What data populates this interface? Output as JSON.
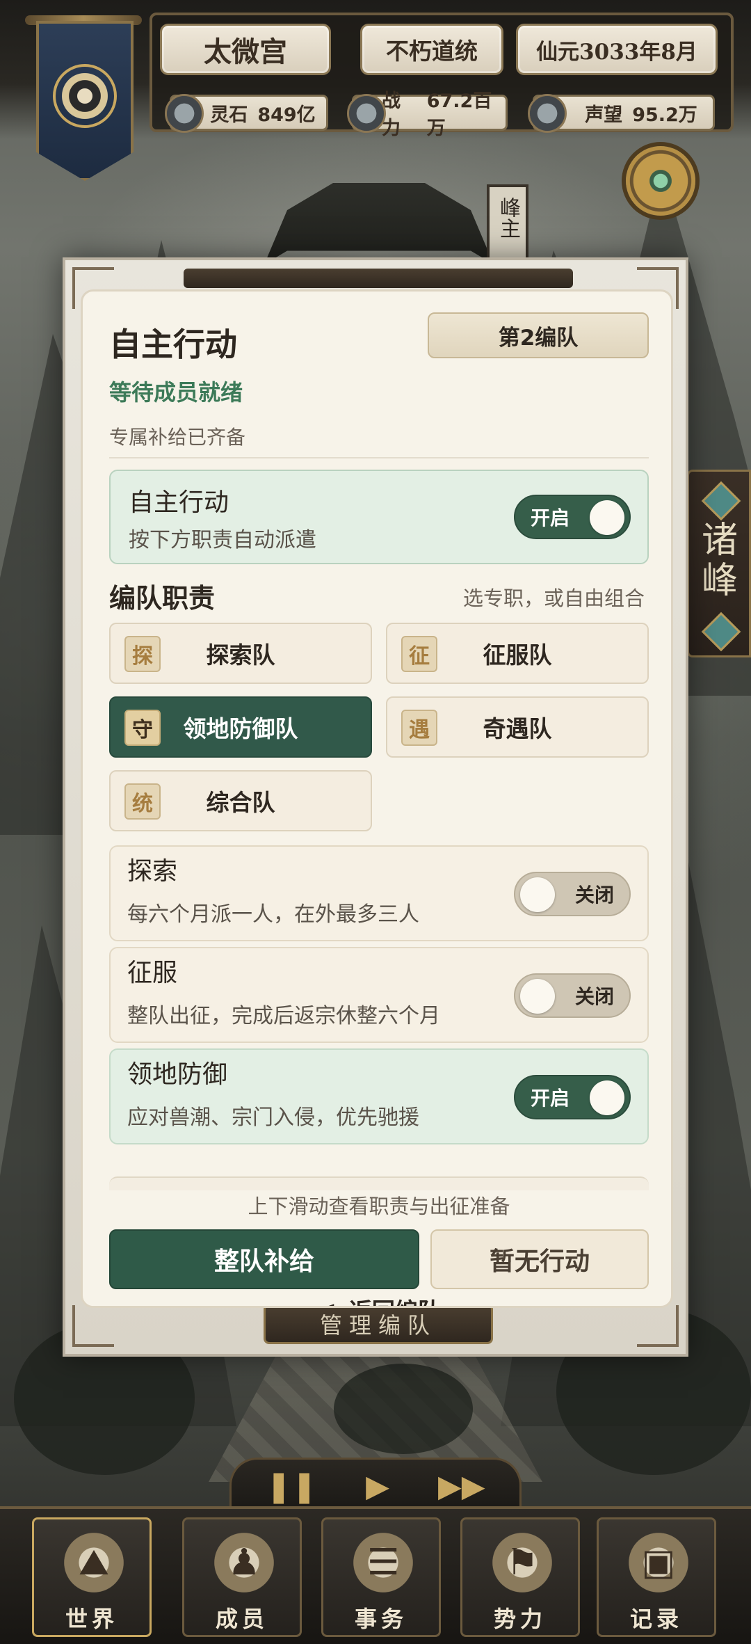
{
  "hud": {
    "sect_name": "太微宫",
    "lineage": "不朽道统",
    "date": "仙元3033年8月",
    "resources": [
      {
        "icon": "spirit-stone-icon",
        "label": "灵石",
        "value": "849亿"
      },
      {
        "icon": "sword-icon",
        "label": "战力",
        "value": "67.2百万"
      },
      {
        "icon": "reputation-icon",
        "label": "声望",
        "value": "95.2万"
      }
    ]
  },
  "scene": {
    "pillar_text": "峰主",
    "side_tab": "诸峰"
  },
  "modal": {
    "title": "自主行动",
    "team_label": "第2编队",
    "status": "等待成员就绪",
    "supply_note": "专属补给已齐备",
    "auto": {
      "title": "自主行动",
      "subtitle": "按下方职责自动派遣",
      "toggle": "开启"
    },
    "duties_title": "编队职责",
    "duties_hint": "选专职，或自由组合",
    "duties": [
      {
        "badge": "探",
        "label": "探索队",
        "selected": false
      },
      {
        "badge": "征",
        "label": "征服队",
        "selected": false
      },
      {
        "badge": "守",
        "label": "领地防御队",
        "selected": true
      },
      {
        "badge": "遇",
        "label": "奇遇队",
        "selected": false
      },
      {
        "badge": "统",
        "label": "综合队",
        "selected": false
      }
    ],
    "roles": [
      {
        "title": "探索",
        "desc": "每六个月派一人，在外最多三人",
        "toggle": "关闭",
        "on": false
      },
      {
        "title": "征服",
        "desc": "整队出征，完成后返宗休整六个月",
        "toggle": "关闭",
        "on": false
      },
      {
        "title": "领地防御",
        "desc": "应对兽潮、宗门入侵，优先驰援",
        "toggle": "开启",
        "on": true
      }
    ],
    "scroll_hint": "上下滑动查看职责与出征准备",
    "primary_button": "整队补给",
    "secondary_button": "暂无行动",
    "back_icon": "<",
    "back_label": "返回编队",
    "footer_plate": "管理编队"
  },
  "playbar": {
    "pause_icon": "pause-icon",
    "play_icon": "play-icon",
    "fast_forward_icon": "fast-forward-icon"
  },
  "nav": [
    {
      "label": "世界",
      "icon": "world-icon"
    },
    {
      "label": "成员",
      "icon": "member-icon"
    },
    {
      "label": "事务",
      "icon": "scroll-icon"
    },
    {
      "label": "势力",
      "icon": "banner-icon"
    },
    {
      "label": "记录",
      "icon": "book-icon"
    }
  ]
}
